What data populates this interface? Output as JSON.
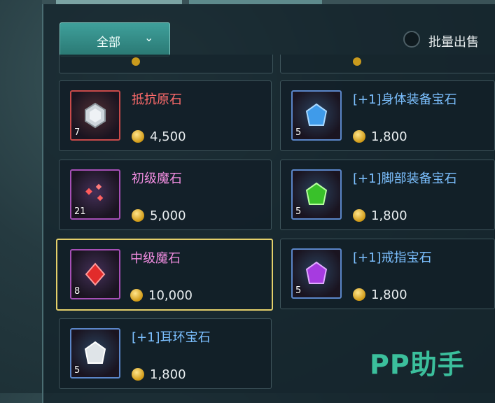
{
  "toolbar": {
    "filter_label": "全部",
    "bulk_sell_label": "批量出售"
  },
  "items": [
    {
      "name": "抵抗原石",
      "price": "4,500",
      "count": "7",
      "name_color": "#ff6b6b",
      "frame_color": "#c94a4a",
      "gem": "silver-crystal-icon"
    },
    {
      "name": "[+1]身体装备宝石",
      "price": "1,800",
      "count": "5",
      "name_color": "#7cc0ff",
      "frame_color": "#5b86c9",
      "gem": "blue-gem-icon"
    },
    {
      "name": "初级魔石",
      "price": "5,000",
      "count": "21",
      "name_color": "#f08de0",
      "frame_color": "#a64fb6",
      "gem": "red-shards-icon"
    },
    {
      "name": "[+1]脚部装备宝石",
      "price": "1,800",
      "count": "5",
      "name_color": "#7cc0ff",
      "frame_color": "#5b86c9",
      "gem": "green-gem-icon"
    },
    {
      "name": "中级魔石",
      "price": "10,000",
      "count": "8",
      "name_color": "#f08de0",
      "frame_color": "#a64fb6",
      "gem": "red-gem-icon",
      "selected": true
    },
    {
      "name": "[+1]戒指宝石",
      "price": "1,800",
      "count": "5",
      "name_color": "#7cc0ff",
      "frame_color": "#5b86c9",
      "gem": "purple-gem-icon"
    },
    {
      "name": "[+1]耳环宝石",
      "price": "1,800",
      "count": "5",
      "name_color": "#7cc0ff",
      "frame_color": "#5b86c9",
      "gem": "white-gem-icon"
    }
  ],
  "watermark": "PP助手"
}
